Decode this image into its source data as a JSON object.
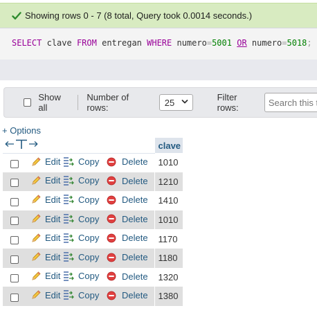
{
  "status": {
    "message": "Showing rows 0 - 7 (8 total, Query took 0.0014 seconds.)",
    "color": "#d8ebc1"
  },
  "sql": {
    "kw_select": "SELECT",
    "column": "clave",
    "kw_from": "FROM",
    "table": "entregan",
    "kw_where": "WHERE",
    "field1": "numero",
    "eq1": "=",
    "value1": "5001",
    "kw_or": "OR",
    "field2": "numero",
    "eq2": "=",
    "value2": "5018",
    "terminator": ";"
  },
  "controls": {
    "show_all_label": "Show all",
    "rows_label": "Number of rows:",
    "rows_value": "25",
    "filter_label": "Filter rows:",
    "filter_placeholder": "Search this table"
  },
  "options_link": "+ Options",
  "table": {
    "header_arrows": "←T→",
    "column_header": "clave",
    "actions": {
      "edit": "Edit",
      "copy": "Copy",
      "delete": "Delete"
    },
    "rows": [
      "1010",
      "1210",
      "1410",
      "1010",
      "1170",
      "1180",
      "1320",
      "1380"
    ]
  },
  "icons": {
    "status": "check-icon",
    "edit": "pencil-icon",
    "copy": "copy-icon",
    "delete": "delete-icon",
    "select": "chevron-down-icon"
  }
}
